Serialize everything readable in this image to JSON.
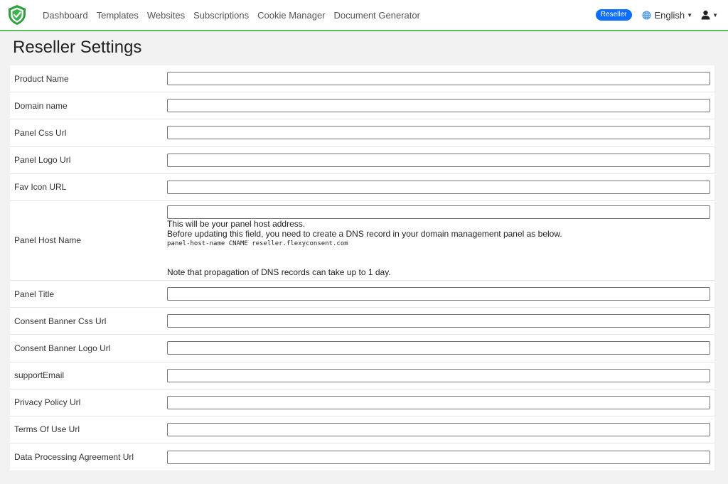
{
  "nav": {
    "links": [
      "Dashboard",
      "Templates",
      "Websites",
      "Subscriptions",
      "Cookie Manager",
      "Document Generator"
    ],
    "badge": "Reseller",
    "language": "English",
    "colors": {
      "accent": "#5cb85c",
      "badge": "#0d6efd"
    }
  },
  "page": {
    "title": "Reseller Settings"
  },
  "form": {
    "fields": [
      {
        "label": "Product Name",
        "value": ""
      },
      {
        "label": "Domain name",
        "value": ""
      },
      {
        "label": "Panel Css Url",
        "value": ""
      },
      {
        "label": "Panel Logo Url",
        "value": ""
      },
      {
        "label": "Fav Icon URL",
        "value": ""
      },
      {
        "label": "Panel Host Name",
        "value": ""
      },
      {
        "label": "Panel Title",
        "value": ""
      },
      {
        "label": "Consent Banner Css Url",
        "value": ""
      },
      {
        "label": "Consent Banner Logo Url",
        "value": ""
      },
      {
        "label": "supportEmail",
        "value": ""
      },
      {
        "label": "Privacy Policy Url",
        "value": ""
      },
      {
        "label": "Terms Of Use Url",
        "value": ""
      },
      {
        "label": "Data Processing Agreement Url",
        "value": ""
      }
    ],
    "host_help": {
      "line1": "This will be your panel host address.",
      "line2": "Before updating this field, you need to create a DNS record in your domain management panel as below.",
      "code": "panel-host-name CNAME reseller.flexyconsent.com",
      "note": "Note that propagation of DNS records can take up to 1 day."
    }
  }
}
